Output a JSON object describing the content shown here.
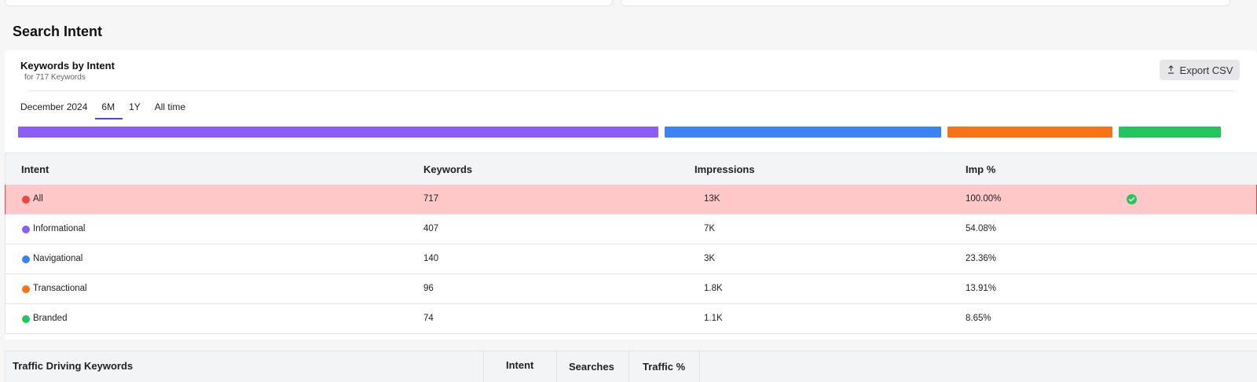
{
  "section_title": "Search Intent",
  "panel": {
    "title": "Keywords by Intent",
    "subtitle": "for 717 Keywords",
    "export_label": "Export CSV",
    "tabs": [
      "December 2024",
      "6M",
      "1Y",
      "All time"
    ],
    "active_tab": "6M"
  },
  "colors": {
    "informational": "#8b5cf6",
    "navigational": "#3b82f6",
    "transactional": "#f97316",
    "branded": "#22c55e",
    "all": "#ef4444",
    "selected_row": "#fec7c8"
  },
  "distribution": [
    {
      "intent": "Informational",
      "share": 54.08
    },
    {
      "intent": "Navigational",
      "share": 23.36
    },
    {
      "intent": "Transactional",
      "share": 13.91
    },
    {
      "intent": "Branded",
      "share": 8.65
    }
  ],
  "table": {
    "headers": [
      "Intent",
      "Keywords",
      "Impressions",
      "Imp %"
    ],
    "rows": [
      {
        "intent": "All",
        "keywords": "717",
        "impressions": "13K",
        "imp_pct": "100.00%",
        "selected": true
      },
      {
        "intent": "Informational",
        "keywords": "407",
        "impressions": "7K",
        "imp_pct": "54.08%"
      },
      {
        "intent": "Navigational",
        "keywords": "140",
        "impressions": "3K",
        "imp_pct": "23.36%"
      },
      {
        "intent": "Transactional",
        "keywords": "96",
        "impressions": "1.8K",
        "imp_pct": "13.91%"
      },
      {
        "intent": "Branded",
        "keywords": "74",
        "impressions": "1.1K",
        "imp_pct": "8.65%"
      }
    ]
  },
  "bottom_table": {
    "headers": [
      "Traffic Driving Keywords",
      "Intent",
      "Searches",
      "Traffic %"
    ]
  }
}
